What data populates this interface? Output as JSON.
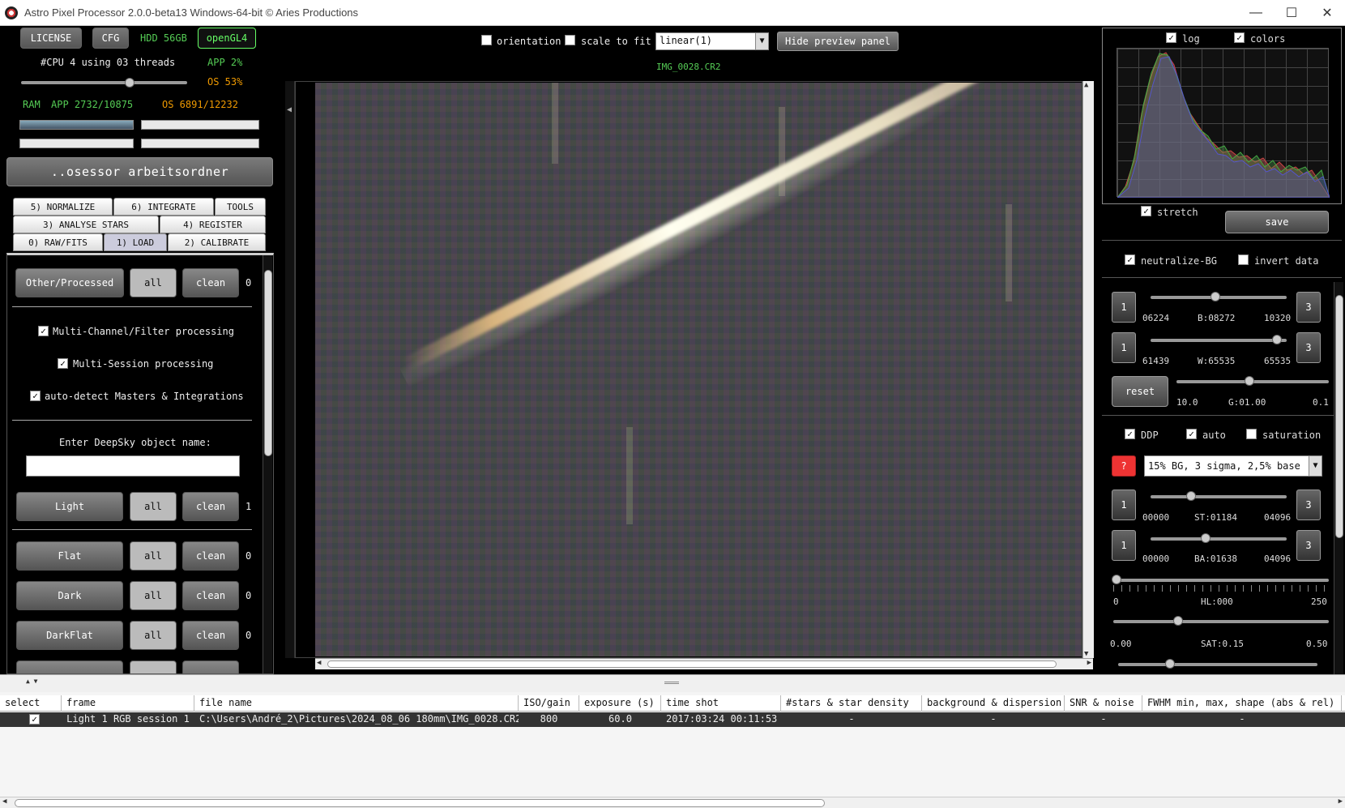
{
  "window": {
    "title": "Astro Pixel Processor 2.0.0-beta13 Windows-64-bit © Aries Productions"
  },
  "left": {
    "license": "LICENSE",
    "cfg": "CFG",
    "hdd": "HDD 56GB",
    "opengl": "openGL4",
    "cpu": "#CPU 4  using 03 threads",
    "app_cpu": "APP 2%",
    "os_cpu": "OS 53%",
    "ram_label": "RAM",
    "ram_app": "APP 2732/10875",
    "ram_os": "OS 6891/12232",
    "workdir": "..osessor arbeitsordner",
    "tabs_row1": [
      "5) NORMALIZE",
      "6) INTEGRATE",
      "TOOLS"
    ],
    "tabs_row2": [
      "3) ANALYSE STARS",
      "4) REGISTER"
    ],
    "tabs_row3": [
      "0) RAW/FITS",
      "1) LOAD",
      "2) CALIBRATE"
    ],
    "load": {
      "other": {
        "label": "Other/Processed",
        "all": "all",
        "clean": "clean",
        "count": "0"
      },
      "multi_channel": "Multi-Channel/Filter processing",
      "multi_session": "Multi-Session processing",
      "auto_detect": "auto-detect Masters & Integrations",
      "deepsky_label": "Enter DeepSky object name:",
      "deepsky_value": "",
      "frames": [
        {
          "label": "Light",
          "all": "all",
          "clean": "clean",
          "count": "1"
        },
        {
          "label": "Flat",
          "all": "all",
          "clean": "clean",
          "count": "0"
        },
        {
          "label": "Dark",
          "all": "all",
          "clean": "clean",
          "count": "0"
        },
        {
          "label": "DarkFlat",
          "all": "all",
          "clean": "clean",
          "count": "0"
        }
      ]
    }
  },
  "center": {
    "orientation": "orientation",
    "scale_to_fit": "scale to fit",
    "stretch_mode": "linear(1)",
    "hide_preview": "Hide preview panel",
    "filename": "IMG_0028.CR2"
  },
  "right": {
    "log": "log",
    "colors": "colors",
    "stretch": "stretch",
    "save": "save",
    "neutralize": "neutralize-BG",
    "invert": "invert data",
    "b": {
      "left": "1",
      "right": "3",
      "min": "06224",
      "val": "B:08272",
      "max": "10320"
    },
    "w": {
      "left": "1",
      "right": "3",
      "min": "61439",
      "val": "W:65535",
      "max": "65535"
    },
    "reset": "reset",
    "g": {
      "min": "10.0",
      "val": "G:01.00",
      "max": "0.1"
    },
    "ddp": "DDP",
    "auto": "auto",
    "saturation": "saturation",
    "help": "?",
    "preset": "15% BG, 3 sigma, 2,5% base",
    "st": {
      "left": "1",
      "right": "3",
      "min": "00000",
      "val": "ST:01184",
      "max": "04096"
    },
    "ba": {
      "left": "1",
      "right": "3",
      "min": "00000",
      "val": "BA:01638",
      "max": "04096"
    },
    "hl": {
      "min": "0",
      "val": "HL:000",
      "max": "250"
    },
    "sat": {
      "min": "0.00",
      "val": "SAT:0.15",
      "max": "0.50"
    }
  },
  "table": {
    "headers": [
      "select",
      "frame",
      "file name",
      "ISO/gain",
      "exposure (s)",
      "time shot",
      "#stars & star density",
      "background & dispersion",
      "SNR & noise",
      "FWHM min, max, shape (abs & rel)"
    ],
    "rows": [
      {
        "select": "✓",
        "frame": "Light 1 RGB session 1",
        "file": "C:\\Users\\André_2\\Pictures\\2024_08_06 180mm\\IMG_0028.CR2",
        "iso": "800",
        "exposure": "60.0",
        "time": "2017:03:24 00:11:53",
        "stars": "-",
        "bg": "-",
        "snr": "-",
        "fwhm": "-"
      }
    ]
  },
  "colors": {
    "green": "#55cc55",
    "orange": "#ee9900",
    "red": "#ee3333"
  }
}
